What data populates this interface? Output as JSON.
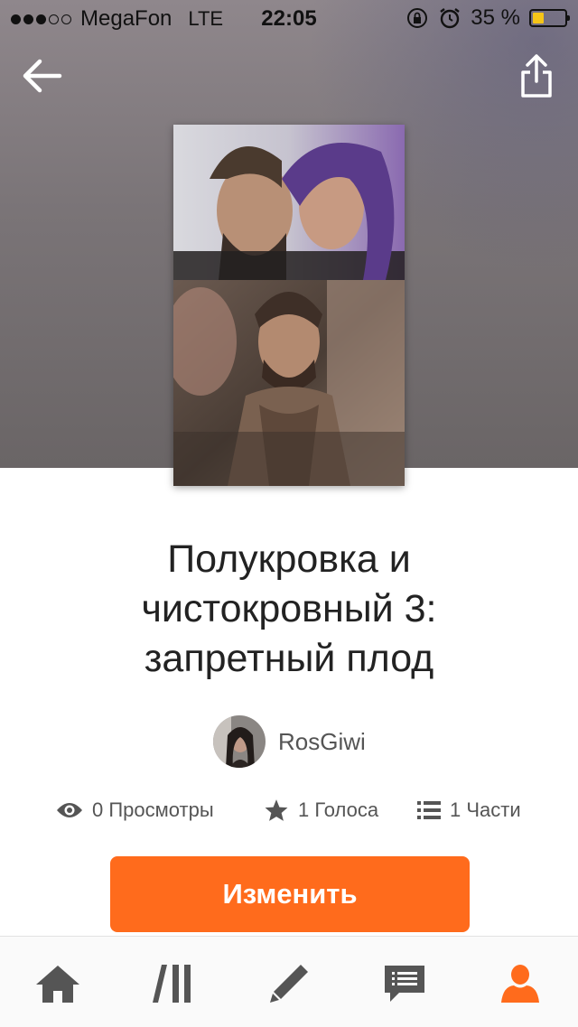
{
  "status_bar": {
    "carrier": "MegaFon",
    "network": "LTE",
    "time": "22:05",
    "battery_percent_label": "35 %",
    "battery_level": 0.35,
    "signal_bars_filled": 3,
    "signal_bars_total": 5
  },
  "header": {
    "back_icon": "arrow-left-icon",
    "share_icon": "share-icon"
  },
  "story": {
    "title_lines": [
      "Полукровка и",
      "чистокровный 3:",
      "запретный плод"
    ],
    "author": "RosGiwi"
  },
  "stats": {
    "views_label": "0 Просмотры",
    "votes_label": "1 Голоса",
    "parts_label": "1 Части"
  },
  "actions": {
    "edit_label": "Изменить"
  },
  "tabbar": {
    "items": [
      "home-icon",
      "library-icon",
      "write-icon",
      "messages-icon",
      "profile-icon"
    ],
    "active": "profile-icon"
  },
  "colors": {
    "accent": "#ff6b1c",
    "tab_inactive": "#555555",
    "text_dark": "#222222",
    "text_muted": "#555555",
    "battery_fill": "#f5c518"
  }
}
